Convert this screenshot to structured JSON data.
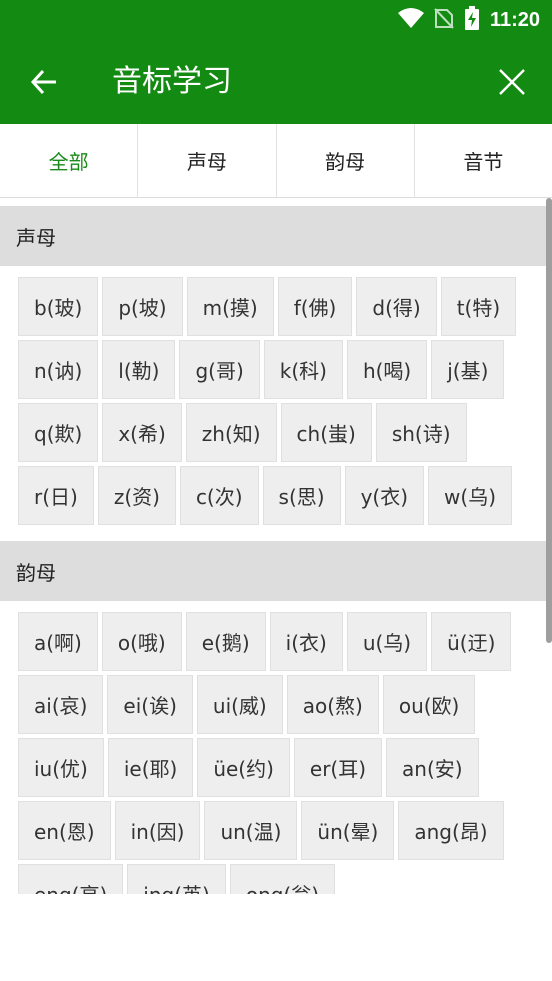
{
  "status": {
    "time": "11:20"
  },
  "appbar": {
    "title": "音标学习"
  },
  "tabs": [
    {
      "label": "全部",
      "active": true
    },
    {
      "label": "声母",
      "active": false
    },
    {
      "label": "韵母",
      "active": false
    },
    {
      "label": "音节",
      "active": false
    }
  ],
  "sections": [
    {
      "title": "声母",
      "items": [
        "b(玻)",
        "p(坡)",
        "m(摸)",
        "f(佛)",
        "d(得)",
        "t(特)",
        "n(讷)",
        "l(勒)",
        "g(哥)",
        "k(科)",
        "h(喝)",
        "j(基)",
        "q(欺)",
        "x(希)",
        "zh(知)",
        "ch(蚩)",
        "sh(诗)",
        "r(日)",
        "z(资)",
        "c(次)",
        "s(思)",
        "y(衣)",
        "w(乌)"
      ]
    },
    {
      "title": "韵母",
      "items": [
        "a(啊)",
        "o(哦)",
        "e(鹅)",
        "i(衣)",
        "u(乌)",
        "ü(迂)",
        "ai(哀)",
        "ei(诶)",
        "ui(威)",
        "ao(熬)",
        "ou(欧)",
        "iu(优)",
        "ie(耶)",
        "üe(约)",
        "er(耳)",
        "an(安)",
        "en(恩)",
        "in(因)",
        "un(温)",
        "ün(晕)",
        "ang(昂)",
        "eng(亨)",
        "ing(英)",
        "ong(翁)"
      ]
    }
  ],
  "colors": {
    "appbar": "#138a12",
    "active_tab": "#1a8a1a",
    "section_header": "#dddddd",
    "chip": "#eeeeee"
  }
}
